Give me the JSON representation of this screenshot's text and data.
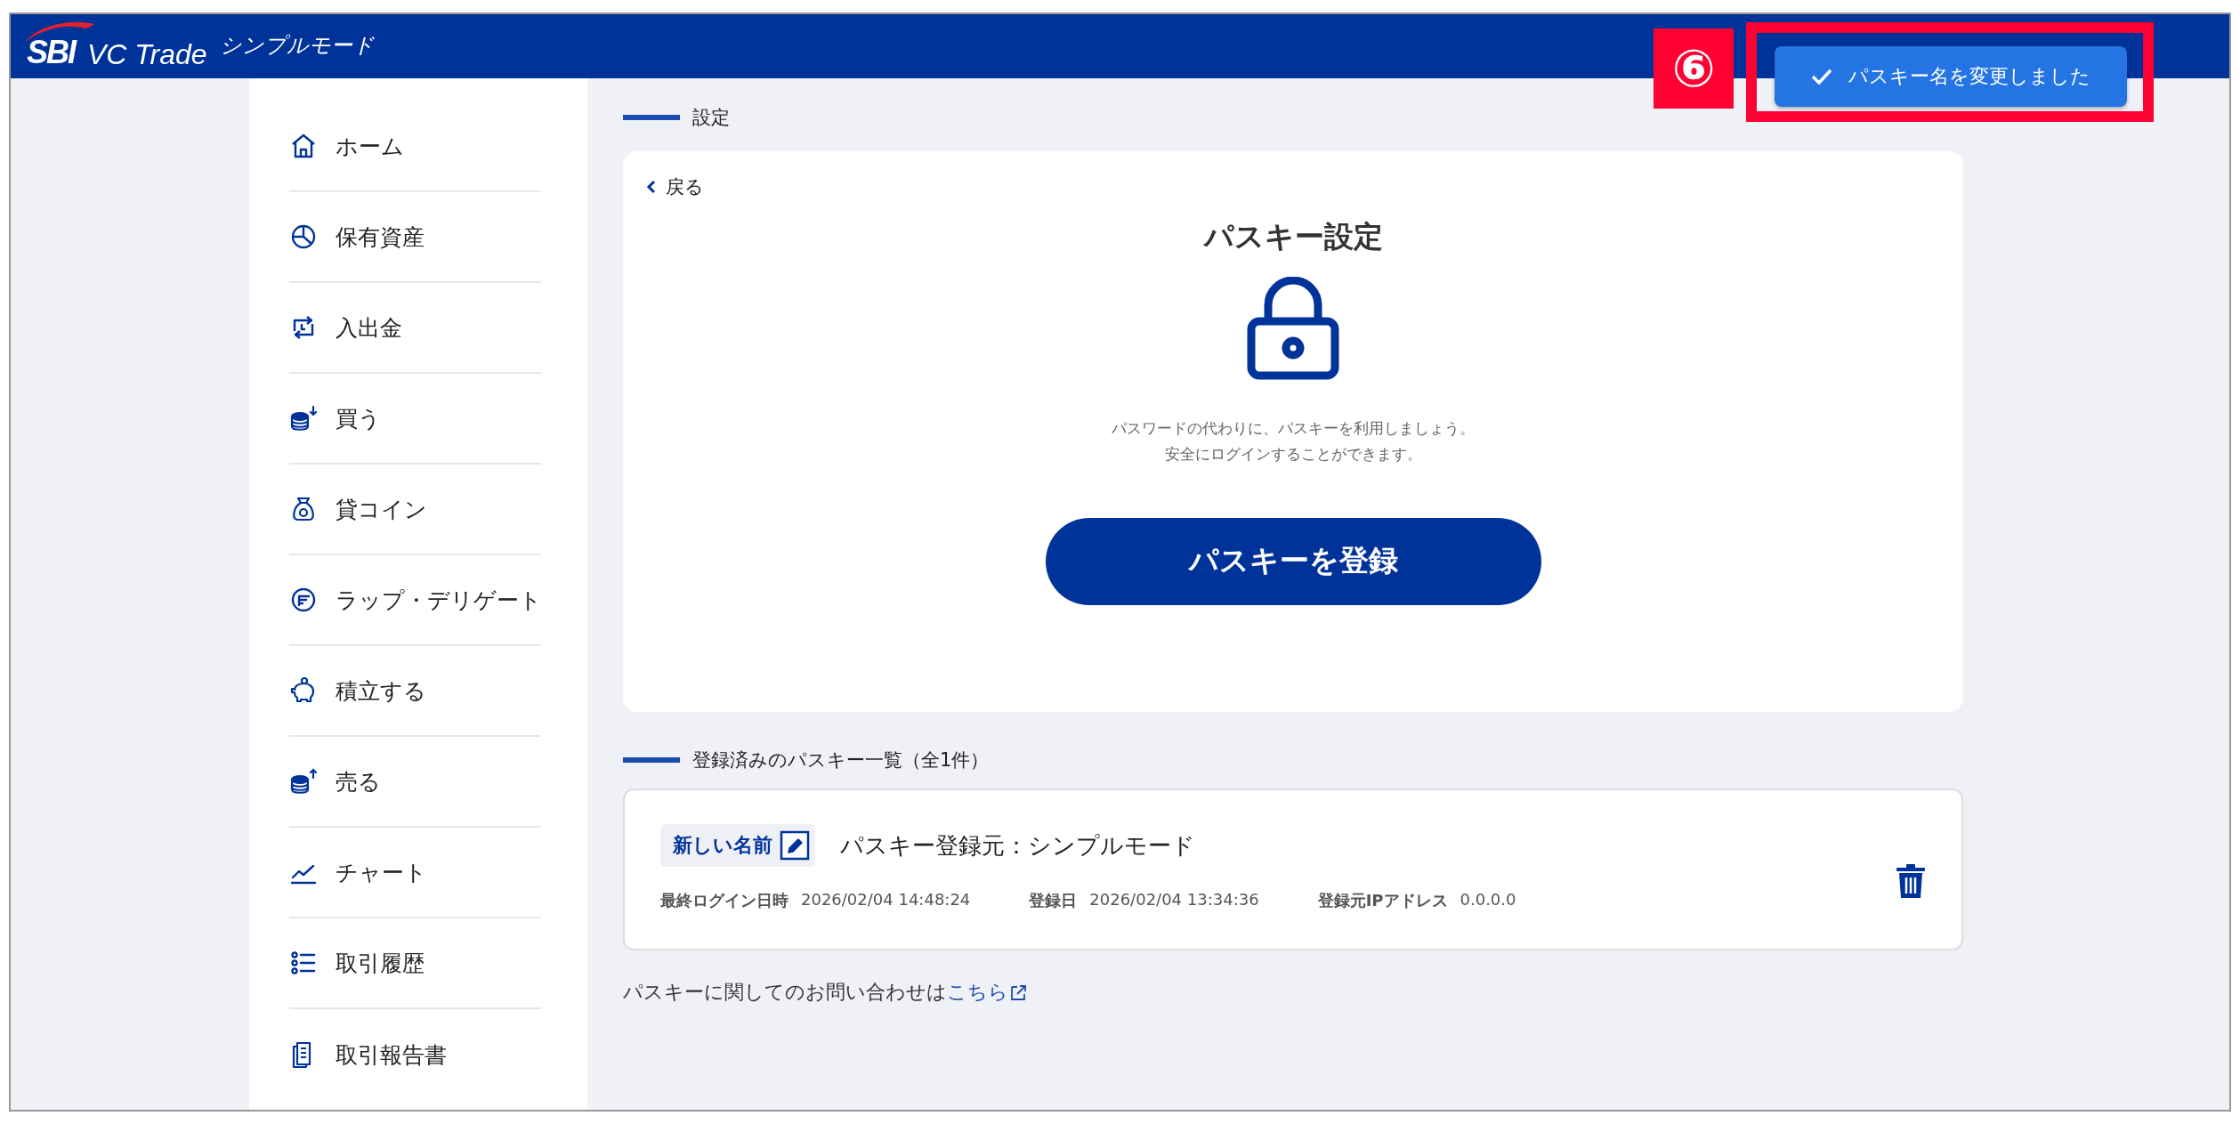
{
  "header": {
    "logo_mark": "SBI",
    "logo_name": "VC Trade",
    "mode": "シンプルモード"
  },
  "annotation": {
    "label": "⑥"
  },
  "toast": {
    "message": "パスキー名を変更しました"
  },
  "sidebar": {
    "items": [
      {
        "label": "ホーム"
      },
      {
        "label": "保有資産"
      },
      {
        "label": "入出金"
      },
      {
        "label": "買う"
      },
      {
        "label": "貸コイン"
      },
      {
        "label": "ラップ・デリゲート"
      },
      {
        "label": "積立する"
      },
      {
        "label": "売る"
      },
      {
        "label": "チャート"
      },
      {
        "label": "取引履歴"
      },
      {
        "label": "取引報告書"
      }
    ]
  },
  "settings": {
    "section_title": "設定",
    "back": "戻る",
    "title": "パスキー設定",
    "description": [
      "パスワードの代わりに、パスキーを利用しましょう。",
      "安全にログインすることができます。"
    ],
    "register_button": "パスキーを登録"
  },
  "passkeys": {
    "section_title": "登録済みのパスキー一覧（全1件）",
    "items": [
      {
        "name": "新しい名前",
        "source": "パスキー登録元：シンプルモード",
        "meta": [
          {
            "label": "最終ログイン日時",
            "value": "2026/02/04 14:48:24"
          },
          {
            "label": "登録日",
            "value": "2026/02/04 13:34:36"
          },
          {
            "label": "登録元IPアドレス",
            "value": "0.0.0.0"
          }
        ]
      }
    ]
  },
  "footer": {
    "text": "パスキーに関してのお問い合わせは",
    "link": "こちら"
  }
}
